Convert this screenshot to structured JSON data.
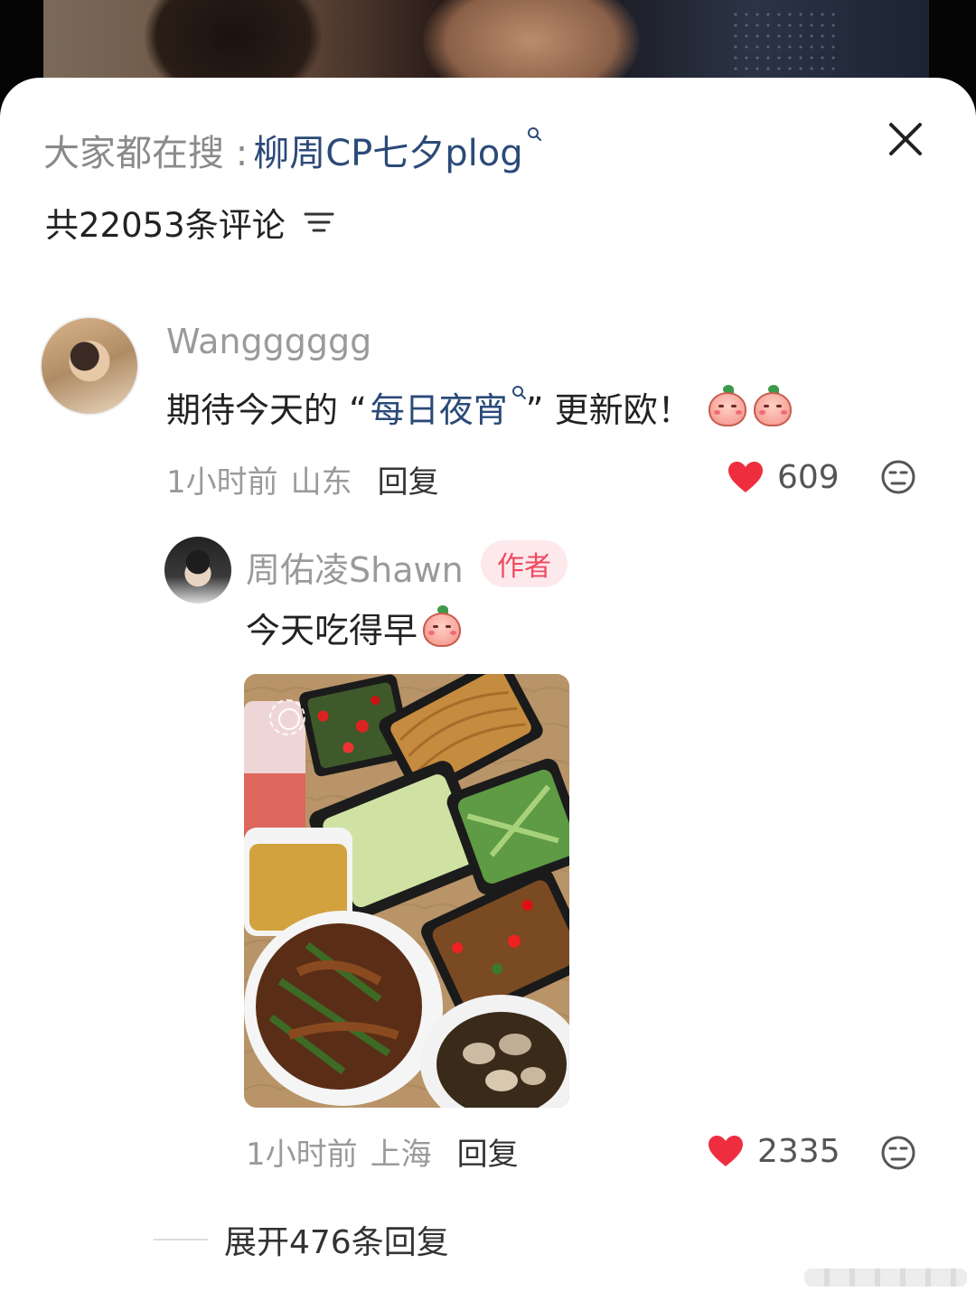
{
  "search": {
    "label": "大家都在搜 : ",
    "term": "柳周CP七夕plog"
  },
  "comments_header": {
    "count_text": "共22053条评论"
  },
  "comments": [
    {
      "username": "Wangggggg",
      "text_before": "期待今天的 “",
      "link_term": "每日夜宵",
      "text_after": "” 更新欧！",
      "time": "1小时前",
      "location": "山东",
      "reply_label": "回复",
      "likes": "609"
    },
    {
      "username": "周佑凌Shawn",
      "badge": "作者",
      "text": "今天吃得早",
      "time": "1小时前",
      "location": "上海",
      "reply_label": "回复",
      "likes": "2335"
    }
  ],
  "expand": {
    "label": "展开476条回复"
  },
  "colors": {
    "link": "#2b4a78",
    "like_red": "#ee2e3f",
    "badge_text": "#f0495e",
    "badge_bg": "#fde9ec"
  },
  "icons": [
    "search-icon",
    "close-icon",
    "filter-icon",
    "heart-icon",
    "dislike-icon",
    "peach-emoji",
    "play-icon"
  ]
}
